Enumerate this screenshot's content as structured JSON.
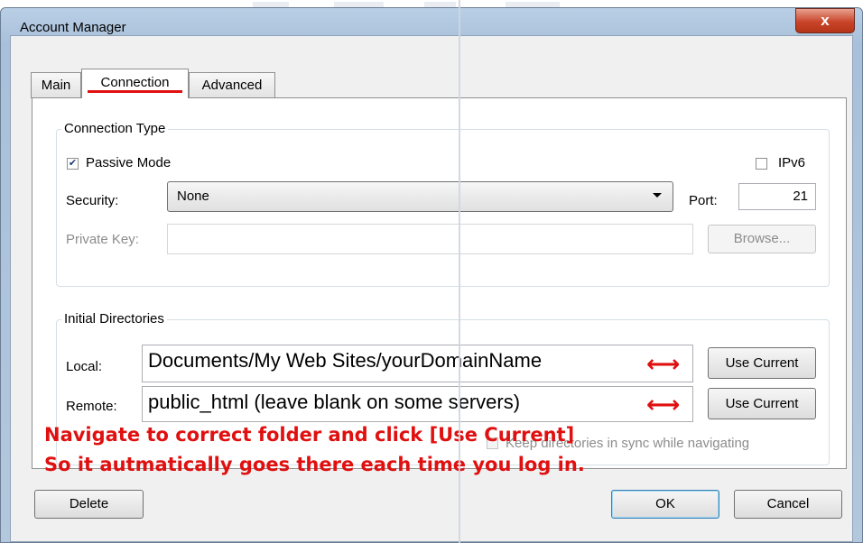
{
  "window": {
    "title": "Account Manager",
    "close_glyph": "x"
  },
  "tabs": [
    {
      "label": "Main",
      "active": false
    },
    {
      "label": "Connection",
      "active": true
    },
    {
      "label": "Advanced",
      "active": false
    }
  ],
  "connection_type": {
    "legend": "Connection Type",
    "passive_mode": {
      "label": "Passive Mode",
      "checked": true,
      "check_glyph": "✔"
    },
    "ipv6": {
      "label": "IPv6",
      "checked": false
    },
    "security": {
      "label": "Security:",
      "value": "None"
    },
    "port": {
      "label": "Port:",
      "value": "21"
    },
    "private_key": {
      "label": "Private Key:",
      "value": "",
      "browse_label": "Browse..."
    }
  },
  "initial_directories": {
    "legend": "Initial Directories",
    "local": {
      "label": "Local:",
      "value": "Documents/My Web Sites/yourDomainName",
      "button": "Use Current"
    },
    "remote": {
      "label": "Remote:",
      "value": "public_html (leave blank on some servers)",
      "button": "Use Current"
    },
    "keep_sync": {
      "label": "Keep directories in sync while navigating",
      "checked": false
    }
  },
  "annotation": {
    "line1": "Navigate to correct folder and click [Use Current]",
    "line2": "So it autmatically goes there each time you log in.",
    "arrow_glyph": "⟷",
    "color": "#e01010"
  },
  "buttons": {
    "delete": "Delete",
    "ok": "OK",
    "cancel": "Cancel"
  }
}
